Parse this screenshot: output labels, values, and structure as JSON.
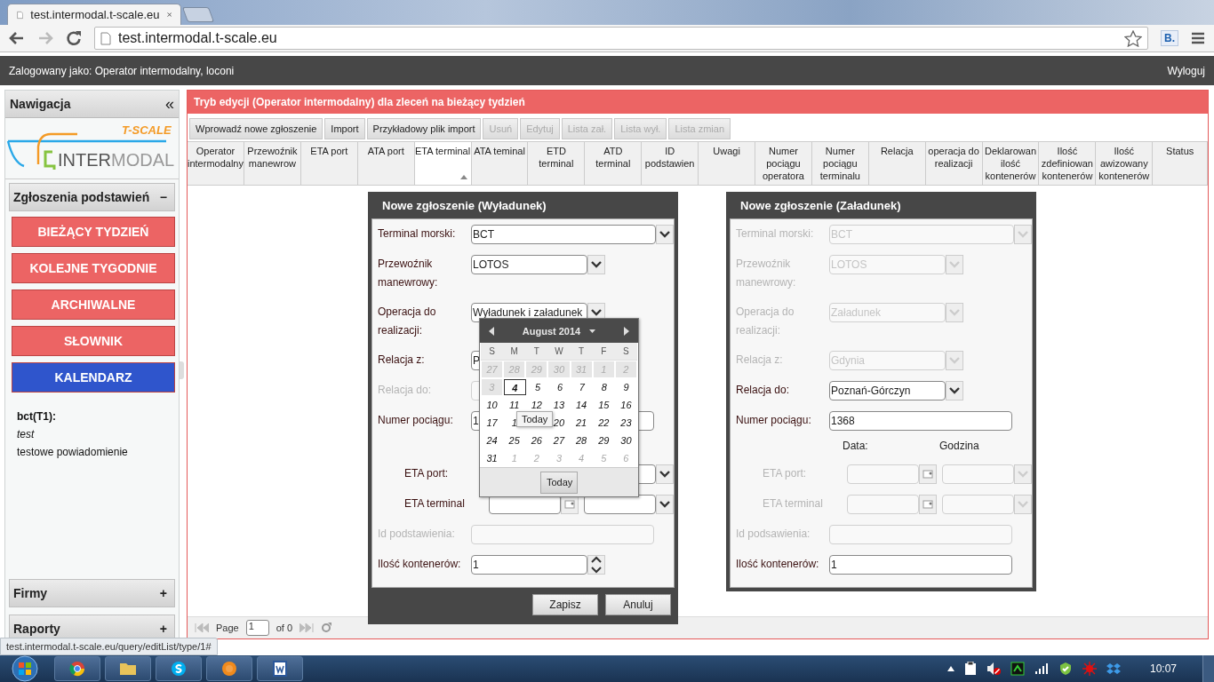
{
  "browser": {
    "tab_title": "test.intermodal.t-scale.eu",
    "url": "test.intermodal.t-scale.eu",
    "extension": "B.",
    "status_url": "test.intermodal.t-scale.eu/query/editList/type/1#"
  },
  "app_bar": {
    "user": "Zalogowany jako: Operator intermodalny, loconi",
    "logout": "Wyloguj"
  },
  "sidebar": {
    "title": "Nawigacja",
    "collapse": "«",
    "logo": {
      "brand": "T-SCALE",
      "first": "INTER",
      "second": "MODAL"
    },
    "sections": [
      {
        "title": "Zgłoszenia podstawień",
        "toggle": "−",
        "items": [
          {
            "label": "BIEŻĄCY TYDZIEŃ",
            "color": "#ec6464"
          },
          {
            "label": "KOLEJNE TYGODNIE",
            "color": "#ec6464"
          },
          {
            "label": "ARCHIWALNE",
            "color": "#ec6464"
          },
          {
            "label": "SŁOWNIK",
            "color": "#ec6464"
          },
          {
            "label": "KALENDARZ",
            "color": "#2f55cc"
          }
        ],
        "notes": [
          {
            "text": "bct(T1):",
            "kind": "heading"
          },
          {
            "text": "test",
            "kind": "italic"
          },
          {
            "text": "testowe powiadomienie",
            "kind": "plain"
          }
        ]
      },
      {
        "title": "Firmy",
        "toggle": "+"
      },
      {
        "title": "Raporty",
        "toggle": "+"
      }
    ]
  },
  "main": {
    "title": "Tryb edycji (Operator intermodalny) dla zleceń na bieżący tydzień",
    "toolbar": [
      {
        "label": "Wprowadź nowe zgłoszenie",
        "disabled": false
      },
      {
        "label": "Import",
        "disabled": false
      },
      {
        "label": "Przykładowy plik import",
        "disabled": false
      },
      {
        "label": "Usuń",
        "disabled": true
      },
      {
        "label": "Edytuj",
        "disabled": true
      },
      {
        "label": "Lista zał.",
        "disabled": true
      },
      {
        "label": "Lista wył.",
        "disabled": true
      },
      {
        "label": "Lista zmian",
        "disabled": true
      }
    ],
    "columns": [
      {
        "label": "Operator intermodalny",
        "sorted": false
      },
      {
        "label": "Przewoźnik manewrow",
        "sorted": false
      },
      {
        "label": "ETA port",
        "sorted": false
      },
      {
        "label": "ATA port",
        "sorted": false
      },
      {
        "label": "ETA terminal",
        "sorted": true
      },
      {
        "label": "ATA teminal",
        "sorted": false
      },
      {
        "label": "ETD terminal",
        "sorted": false
      },
      {
        "label": "ATD terminal",
        "sorted": false
      },
      {
        "label": "ID podstawien",
        "sorted": false
      },
      {
        "label": "Uwagi",
        "sorted": false
      },
      {
        "label": "Numer pociągu operatora",
        "sorted": false
      },
      {
        "label": "Numer pociągu terminalu",
        "sorted": false
      },
      {
        "label": "Relacja",
        "sorted": false
      },
      {
        "label": "operacja do realizacji",
        "sorted": false
      },
      {
        "label": "Deklarowan ilość kontenerów",
        "sorted": false
      },
      {
        "label": "Ilość zdefiniowan kontenerów",
        "sorted": false
      },
      {
        "label": "Ilość awizowany kontenerów",
        "sorted": false
      },
      {
        "label": "Status",
        "sorted": false
      }
    ],
    "pager": {
      "page_label": "Page",
      "page": "1",
      "of": "of 0"
    }
  },
  "dialogs": [
    {
      "title": "Nowe zgłoszenie (Wyładunek)",
      "fields": [
        {
          "kind": "select",
          "label": "Terminal morski:",
          "value": "BCT",
          "wide": true,
          "disabled": false
        },
        {
          "kind": "select",
          "label": "Przewoźnik manewrowy:",
          "value": "LOTOS",
          "wide": false,
          "disabled": false
        },
        {
          "kind": "select",
          "label": "Operacja do realizacji:",
          "value": "Wyładunek i załadunek",
          "wide": false,
          "disabled": false
        },
        {
          "kind": "select",
          "label": "Relacja z:",
          "value": "P",
          "wide": false,
          "disabled": false
        },
        {
          "kind": "select",
          "label": "Relacja do:",
          "wide": false,
          "disabled": true
        },
        {
          "kind": "text",
          "label": "Numer pociągu:",
          "value": "1",
          "disabled": false
        },
        {
          "kind": "header"
        },
        {
          "kind": "datetime",
          "label": "ETA port:",
          "disabled": false
        },
        {
          "kind": "datetime",
          "label": "ETA terminal",
          "disabled": false
        },
        {
          "kind": "text",
          "label": "Id podstawienia:",
          "disabled": true
        },
        {
          "kind": "number",
          "label": "Ilość kontenerów:",
          "value": "1",
          "disabled": false
        }
      ],
      "buttons": [
        "Zapisz",
        "Anuluj"
      ],
      "calendar": {
        "month": "August 2014",
        "weekdays": [
          "S",
          "M",
          "T",
          "W",
          "T",
          "F",
          "S"
        ],
        "weeks": [
          [
            {
              "text": "27",
              "kind": "prev"
            },
            {
              "text": "28",
              "kind": "prev"
            },
            {
              "text": "29",
              "kind": "prev"
            },
            {
              "text": "30",
              "kind": "prev"
            },
            {
              "text": "31",
              "kind": "prev"
            },
            {
              "text": "1",
              "kind": "prev"
            },
            {
              "text": "2",
              "kind": "prev"
            }
          ],
          [
            {
              "text": "3",
              "kind": "prev"
            },
            {
              "text": "4",
              "kind": "today"
            },
            {
              "text": "5",
              "kind": "day"
            },
            {
              "text": "6",
              "kind": "day"
            },
            {
              "text": "7",
              "kind": "day"
            },
            {
              "text": "8",
              "kind": "day"
            },
            {
              "text": "9",
              "kind": "day"
            }
          ],
          [
            {
              "text": "10",
              "kind": "day"
            },
            {
              "text": "11",
              "kind": "day"
            },
            {
              "text": "12",
              "kind": "day"
            },
            {
              "text": "13",
              "kind": "day"
            },
            {
              "text": "14",
              "kind": "day"
            },
            {
              "text": "15",
              "kind": "day"
            },
            {
              "text": "16",
              "kind": "day"
            }
          ],
          [
            {
              "text": "17",
              "kind": "day"
            },
            {
              "text": "1",
              "kind": "day"
            },
            {
              "kind": "day"
            },
            {
              "text": "20",
              "kind": "day"
            },
            {
              "text": "21",
              "kind": "day"
            },
            {
              "text": "22",
              "kind": "day"
            },
            {
              "text": "23",
              "kind": "day"
            }
          ],
          [
            {
              "text": "24",
              "kind": "day"
            },
            {
              "text": "25",
              "kind": "day"
            },
            {
              "text": "26",
              "kind": "day"
            },
            {
              "text": "27",
              "kind": "day"
            },
            {
              "text": "28",
              "kind": "day"
            },
            {
              "text": "29",
              "kind": "day"
            },
            {
              "text": "30",
              "kind": "day"
            }
          ],
          [
            {
              "text": "31",
              "kind": "day"
            },
            {
              "text": "1",
              "kind": "next"
            },
            {
              "text": "2",
              "kind": "next"
            },
            {
              "text": "3",
              "kind": "next"
            },
            {
              "text": "4",
              "kind": "next"
            },
            {
              "text": "5",
              "kind": "next"
            },
            {
              "text": "6",
              "kind": "next"
            }
          ]
        ],
        "today_button": "Today",
        "tooltip": "Today"
      }
    },
    {
      "title": "Nowe zgłoszenie (Załadunek)",
      "fields": [
        {
          "kind": "select",
          "label": "Terminal morski:",
          "value": "BCT",
          "wide": true,
          "disabled": true
        },
        {
          "kind": "select",
          "label": "Przewoźnik manewrowy:",
          "value": "LOTOS",
          "wide": false,
          "disabled": true
        },
        {
          "kind": "select",
          "label": "Operacja do realizacji:",
          "value": "Załadunek",
          "wide": false,
          "disabled": true
        },
        {
          "kind": "select",
          "label": "Relacja z:",
          "value": "Gdynia",
          "wide": false,
          "disabled": true
        },
        {
          "kind": "select",
          "label": "Relacja do:",
          "value": "Poznań-Górczyn",
          "wide": false,
          "disabled": false
        },
        {
          "kind": "text",
          "label": "Numer pociągu:",
          "value": "1368",
          "disabled": false
        },
        {
          "kind": "header",
          "date": "Data:",
          "hour": "Godzina"
        },
        {
          "kind": "datetime",
          "label": "ETA port:",
          "disabled": true
        },
        {
          "kind": "datetime",
          "label": "ETA terminal",
          "disabled": true
        },
        {
          "kind": "text",
          "label": "Id podsawienia:",
          "disabled": true
        },
        {
          "kind": "text",
          "label": "Ilość kontenerów:",
          "value": "1",
          "disabled": false
        }
      ]
    }
  ],
  "taskbar": {
    "time": "10:07"
  }
}
